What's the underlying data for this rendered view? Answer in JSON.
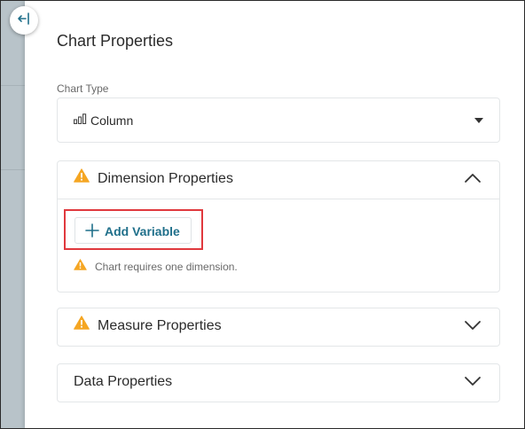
{
  "panel": {
    "title": "Chart Properties",
    "collapse_icon": "collapse-panel-icon"
  },
  "chart_type": {
    "label": "Chart Type",
    "selected": "Column",
    "icon": "column-chart-icon"
  },
  "sections": {
    "dimension": {
      "title": "Dimension Properties",
      "expanded": true,
      "warning": true,
      "add_button_label": "Add Variable",
      "message": "Chart requires one dimension."
    },
    "measure": {
      "title": "Measure Properties",
      "expanded": false,
      "warning": true
    },
    "data": {
      "title": "Data Properties",
      "expanded": false,
      "warning": false
    }
  },
  "colors": {
    "warning": "#f5a623",
    "accent": "#1f6f8a",
    "highlight": "#e0393e"
  }
}
